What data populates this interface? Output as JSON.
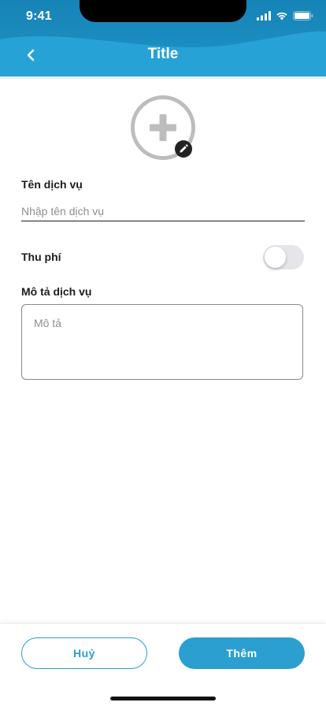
{
  "status_bar": {
    "time": "9:41"
  },
  "header": {
    "title": "Title",
    "back_icon": "chevron-left-icon"
  },
  "avatar": {
    "icon": "plus-icon",
    "badge_icon": "pencil-icon"
  },
  "form": {
    "service_name": {
      "label": "Tên dịch vụ",
      "placeholder": "Nhập tên dịch vụ",
      "value": ""
    },
    "fee": {
      "label": "Thu phí",
      "enabled": false
    },
    "description": {
      "label": "Mô tả dịch vụ",
      "placeholder": "Mô tả",
      "value": ""
    }
  },
  "footer": {
    "cancel_label": "Huỷ",
    "add_label": "Thêm"
  },
  "colors": {
    "header_dark": "#1a73ad",
    "header_light": "#2aa3d6",
    "accent": "#2a9fd0",
    "toggle_off": "#e5e5ea",
    "avatar_gray": "#bdbdbd"
  }
}
